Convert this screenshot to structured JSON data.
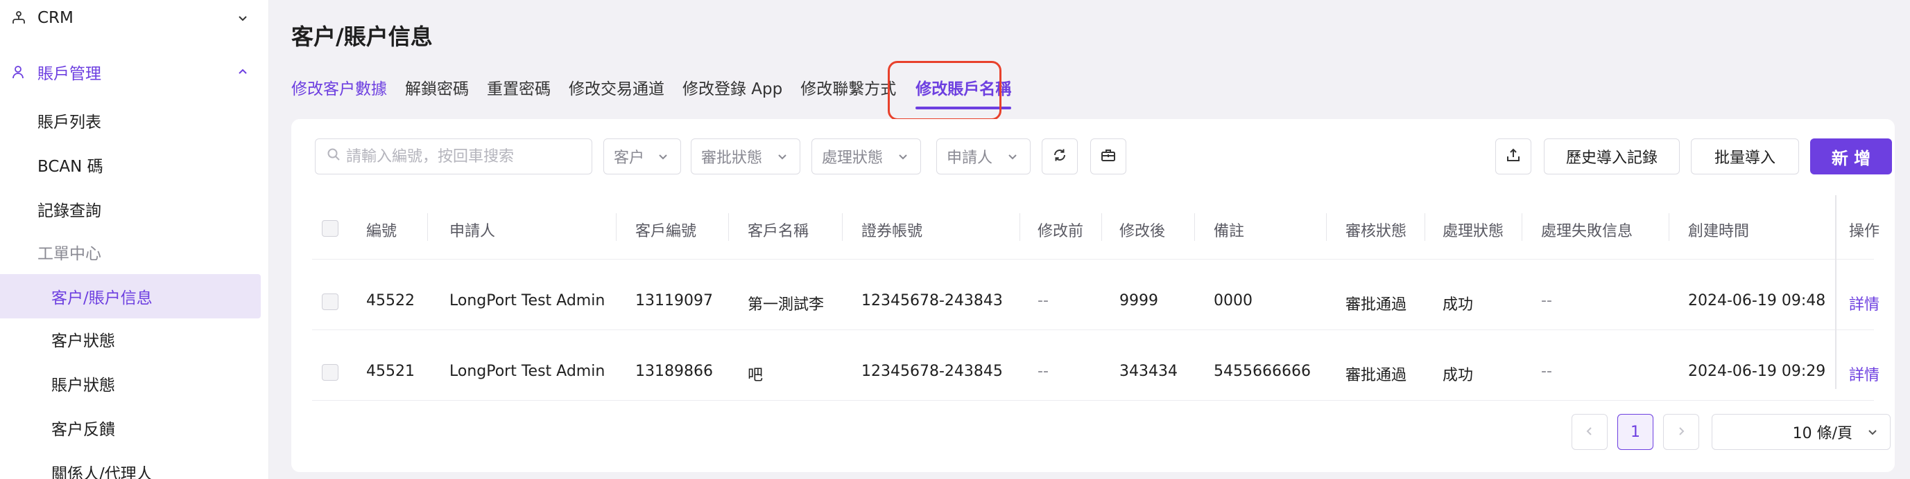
{
  "sidebar": {
    "crm": {
      "label": "CRM",
      "icon": "org-chart-icon"
    },
    "account_mgmt": {
      "label": "賬戶管理",
      "icon": "user-icon"
    },
    "items": [
      {
        "label": "賬戶列表"
      },
      {
        "label": "BCAN 碼"
      },
      {
        "label": "記錄查詢"
      },
      {
        "label": "工單中心"
      },
      {
        "label": "客户/賬户信息"
      },
      {
        "label": "客户狀態"
      },
      {
        "label": "賬户狀態"
      },
      {
        "label": "客户反饋"
      },
      {
        "label": "關係人/代理人"
      }
    ]
  },
  "page": {
    "title": "客户/賬户信息"
  },
  "tabs": [
    {
      "label": "修改客户數據"
    },
    {
      "label": "解鎖密碼"
    },
    {
      "label": "重置密碼"
    },
    {
      "label": "修改交易通道"
    },
    {
      "label": "修改登錄 App"
    },
    {
      "label": "修改聯繫方式"
    },
    {
      "label": "修改賬戶名稱"
    }
  ],
  "toolbar": {
    "search_placeholder": "請輸入編號，按回車搜索",
    "filter_customer": "客户",
    "filter_approval": "審批狀態",
    "filter_process": "處理狀態",
    "filter_applicant": "申請人",
    "import_history": "歷史導入記錄",
    "batch_import": "批量導入",
    "add_new": "新 增"
  },
  "table": {
    "headers": [
      "編號",
      "申請人",
      "客戶編號",
      "客戶名稱",
      "證券帳號",
      "修改前",
      "修改後",
      "備註",
      "審核狀態",
      "處理狀態",
      "處理失敗信息",
      "創建時間",
      "操作"
    ],
    "rows": [
      [
        "45522",
        "LongPort Test Admin",
        "13119097",
        "第一測試李",
        "12345678-243843",
        "--",
        "9999",
        "0000",
        "審批通過",
        "成功",
        "--",
        "2024-06-19 09:48",
        "詳情"
      ],
      [
        "45521",
        "LongPort Test Admin",
        "13189866",
        "吧",
        "12345678-243845",
        "--",
        "343434",
        "5455666666",
        "審批通過",
        "成功",
        "--",
        "2024-06-19 09:29",
        "詳情"
      ]
    ]
  },
  "pagination": {
    "current": "1",
    "page_size": "10 條/頁"
  },
  "colors": {
    "accent": "#6d3fe0",
    "highlight": "#e8412c"
  }
}
